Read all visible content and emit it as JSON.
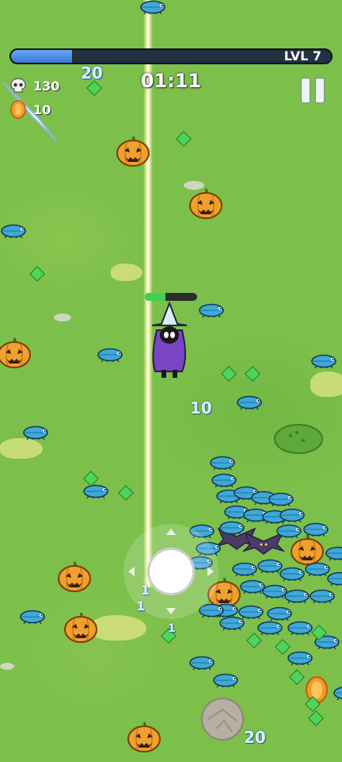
{
  "hud": {
    "level_label": "LVL 7",
    "xp_fraction": 0.19,
    "kills": "130",
    "coins": "10",
    "timer": "01:11",
    "hp_fraction": 0.4
  },
  "icons": {
    "kills": "skull-icon",
    "coins": "coin-icon",
    "pause": "pause-icon"
  },
  "damage_numbers": [
    "20",
    "10",
    "20",
    "1",
    "1",
    "1"
  ],
  "colors": {
    "grass": "#7cbf4a",
    "xp_fill": "#3a7bd6",
    "hp_fill": "#3fd050",
    "hero_cloak": "#7a45c4",
    "gem": "#4fd35a"
  }
}
